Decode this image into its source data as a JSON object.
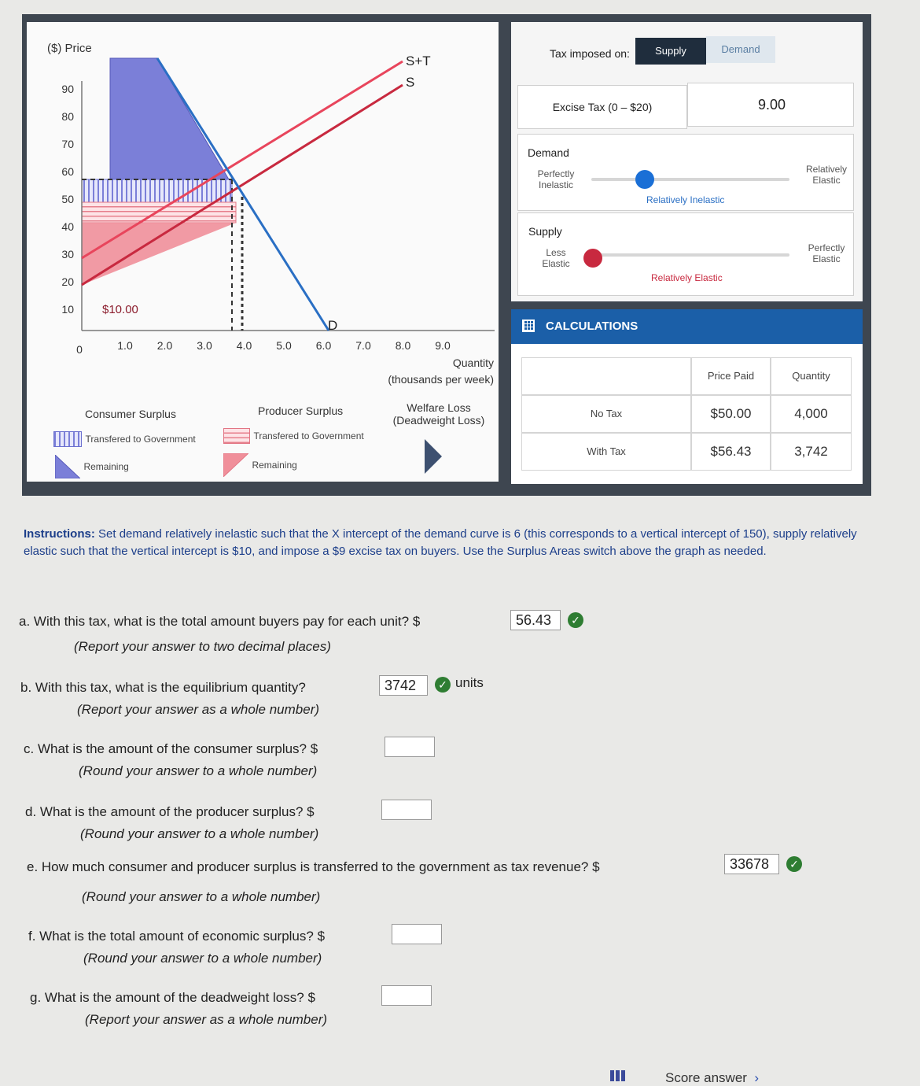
{
  "graph": {
    "y_axis_label": "($) Price",
    "x_axis_label_line1": "Quantity",
    "x_axis_label_line2": "(thousands per week)",
    "y_ticks": [
      "90",
      "80",
      "70",
      "60",
      "50",
      "40",
      "30",
      "20",
      "10"
    ],
    "x_ticks": [
      "0",
      "1.0",
      "2.0",
      "3.0",
      "4.0",
      "5.0",
      "6.0",
      "7.0",
      "8.0",
      "9.0"
    ],
    "curve_labels": {
      "supply_tax": "S+T",
      "supply": "S",
      "demand": "D"
    },
    "intercept_label": "$10.00",
    "colors": {
      "demand": "#2a6fc4",
      "supply": "#c8293f",
      "supply_tax": "#e8455c",
      "consumer_surplus": "#7b7fd8",
      "producer_surplus": "#ef8a95"
    }
  },
  "legend": {
    "consumer_surplus": "Consumer Surplus",
    "producer_surplus": "Producer Surplus",
    "welfare_loss_line1": "Welfare Loss",
    "welfare_loss_line2": "(Deadweight Loss)",
    "transferred": "Transfered to Government",
    "remaining": "Remaining"
  },
  "controls": {
    "tax_imposed_on": "Tax imposed on:",
    "supply_button": "Supply",
    "demand_button": "Demand",
    "excise_tax_label": "Excise Tax (0 – $20)",
    "excise_tax_value": "9.00",
    "demand_heading": "Demand",
    "demand_left_line1": "Perfectly",
    "demand_left_line2": "Inelastic",
    "demand_right_line1": "Relatively",
    "demand_right_line2": "Elastic",
    "demand_current": "Relatively Inelastic",
    "supply_heading": "Supply",
    "supply_left_line1": "Less",
    "supply_left_line2": "Elastic",
    "supply_right_line1": "Perfectly",
    "supply_right_line2": "Elastic",
    "supply_current": "Relatively Elastic"
  },
  "calculations": {
    "title": "CALCULATIONS",
    "col_price": "Price Paid",
    "col_quantity": "Quantity",
    "row_no_tax": "No Tax",
    "row_with_tax": "With Tax",
    "no_tax_price": "$50.00",
    "no_tax_quantity": "4,000",
    "with_tax_price": "$56.43",
    "with_tax_quantity": "3,742"
  },
  "instructions": {
    "label": "Instructions:",
    "text": "Set demand relatively inelastic such that the X intercept of the demand curve is 6 (this corresponds to a vertical intercept of 150), supply relatively elastic such that the vertical intercept is $10, and impose a $9 excise tax on buyers. Use the Surplus Areas switch above the graph as needed."
  },
  "questions": {
    "a": {
      "text": "a. With this tax, what is the total amount buyers pay for each unit?",
      "prefix": "$",
      "answer": "56.43",
      "note": "(Report your answer to two decimal places)"
    },
    "b": {
      "text": "b. With this tax, what is the equilibrium quantity?",
      "answer": "3742",
      "suffix": "units",
      "note": "(Report your answer as a whole number)"
    },
    "c": {
      "text": "c. What is the amount of the consumer surplus?",
      "prefix": "$",
      "answer": "",
      "note": "(Round your answer to a whole number)"
    },
    "d": {
      "text": "d. What is the amount of the producer surplus?",
      "prefix": "$",
      "answer": "",
      "note": "(Round your answer to a whole number)"
    },
    "e": {
      "text": "e. How much consumer and producer surplus is transferred to the government as tax revenue?",
      "prefix": "$",
      "answer": "33678",
      "note": "(Round your answer to a whole number)"
    },
    "f": {
      "text": "f. What is the total amount of economic surplus?",
      "prefix": "$",
      "answer": "",
      "note": "(Round your answer to a whole number)"
    },
    "g": {
      "text": "g. What is the amount of the deadweight loss?",
      "prefix": "$",
      "answer": "",
      "note": "(Report your answer as a whole number)"
    }
  },
  "footer": {
    "score_answer": "Score answer"
  }
}
